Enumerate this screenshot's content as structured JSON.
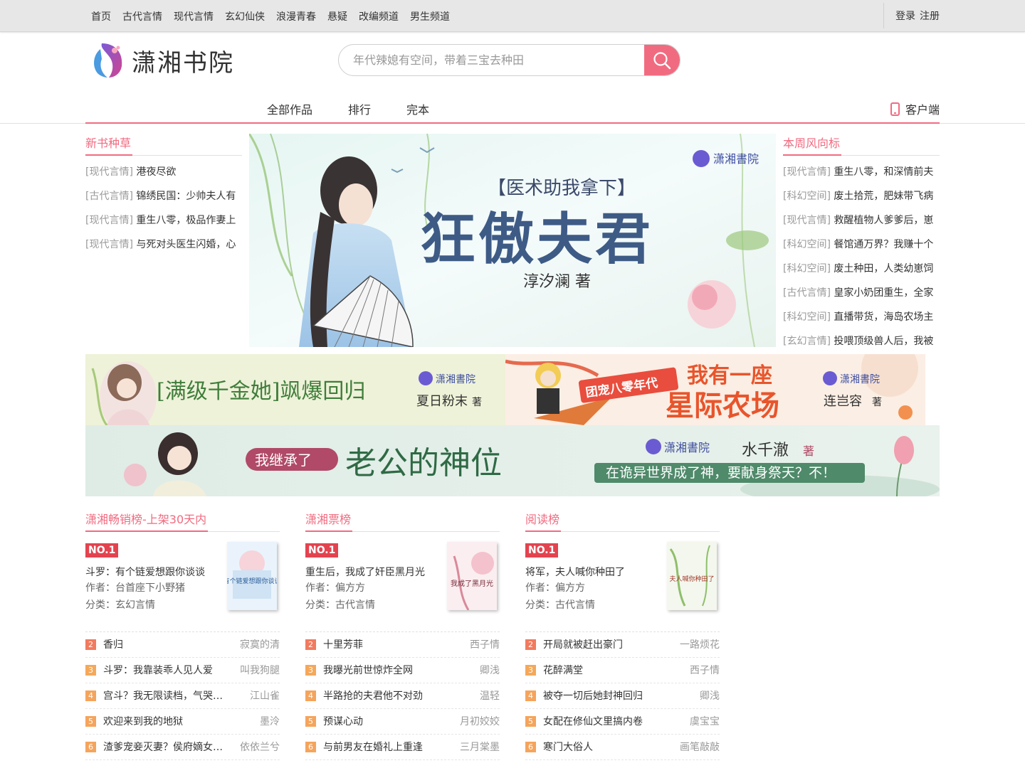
{
  "topnav": {
    "items": [
      "首页",
      "古代言情",
      "现代言情",
      "玄幻仙侠",
      "浪漫青春",
      "悬疑",
      "改编频道",
      "男生频道"
    ],
    "login": "登录",
    "register": "注册"
  },
  "header": {
    "logo_text": "潇湘书院",
    "search_placeholder": "年代辣媳有空间，带着三宝去种田"
  },
  "mainnav": {
    "items": [
      "全部作品",
      "排行",
      "完本"
    ],
    "client": "客户端"
  },
  "new_books": {
    "title": "新书种草",
    "items": [
      {
        "cat": "[现代言情]",
        "name": "港夜尽欲"
      },
      {
        "cat": "[古代言情]",
        "name": "锦绣民国：少帅夫人有"
      },
      {
        "cat": "[现代言情]",
        "name": "重生八零，极品作妻上"
      },
      {
        "cat": "[现代言情]",
        "name": "与死对头医生闪婚，心"
      }
    ]
  },
  "weekly": {
    "title": "本周风向标",
    "items": [
      {
        "cat": "[现代言情]",
        "name": "重生八零，和深情前夫"
      },
      {
        "cat": "[科幻空间]",
        "name": "废土拾荒，肥妹带飞病"
      },
      {
        "cat": "[现代言情]",
        "name": "救醒植物人爹爹后，崽"
      },
      {
        "cat": "[科幻空间]",
        "name": "餐馆通万界？我赚十个"
      },
      {
        "cat": "[科幻空间]",
        "name": "废土种田，人类幼崽饲"
      },
      {
        "cat": "[古代言情]",
        "name": "皇家小奶团重生，全家"
      },
      {
        "cat": "[科幻空间]",
        "name": "直播带货，海岛农场主"
      },
      {
        "cat": "[玄幻言情]",
        "name": "投喂顶级兽人后，我被"
      }
    ]
  },
  "banners": {
    "main": {
      "tagline": "【医术助我拿下】",
      "title": "狂傲夫君",
      "author": "淳汐澜 著",
      "brand": "潇湘書院"
    },
    "b2": {
      "title": "[满级千金她]飒爆回归",
      "author": "夏日粉末",
      "zhu": "著",
      "brand": "潇湘書院"
    },
    "b3": {
      "tag": "团宠八零年代",
      "title1": "我有一座",
      "title2": "星际农场",
      "author": "连岂容",
      "zhu": "著",
      "brand": "潇湘書院"
    },
    "b4": {
      "lead": "我继承了",
      "title": "老公的神位",
      "author": "水千澈",
      "zhu": "著",
      "sub": "在诡异世界成了神，要献身祭天？不！",
      "brand": "潇湘書院"
    }
  },
  "ranks": [
    {
      "title": "潇湘畅销榜-上架30天内",
      "no1_label": "NO.1",
      "top": {
        "title": "斗罗：有个链爱想跟你谈谈",
        "author": "作者：台首座下小野猪",
        "category": "分类：玄幻言情",
        "cover_text": "有个链爱想跟你谈谈"
      },
      "list": [
        {
          "n": "2",
          "name": "香归",
          "author": "寂寞的清"
        },
        {
          "n": "3",
          "name": "斗罗：我靠装乖人见人爱",
          "author": "叫我狗腿"
        },
        {
          "n": "4",
          "name": "宫斗？我无限读档，气哭…",
          "author": "江山雀"
        },
        {
          "n": "5",
          "name": "欢迎来到我的地狱",
          "author": "墨泠"
        },
        {
          "n": "6",
          "name": "渣爹宠妾灭妻？侯府嫡女…",
          "author": "依依兰兮"
        }
      ]
    },
    {
      "title": "潇湘票榜",
      "no1_label": "NO.1",
      "top": {
        "title": "重生后，我成了奸臣黑月光",
        "author": "作者：偏方方",
        "category": "分类：古代言情",
        "cover_text": "我成了黑月光"
      },
      "list": [
        {
          "n": "2",
          "name": "十里芳菲",
          "author": "西子情"
        },
        {
          "n": "3",
          "name": "我曝光前世惊炸全网",
          "author": "卿浅"
        },
        {
          "n": "4",
          "name": "半路抢的夫君他不对劲",
          "author": "温轻"
        },
        {
          "n": "5",
          "name": "预谋心动",
          "author": "月初姣姣"
        },
        {
          "n": "6",
          "name": "与前男友在婚礼上重逢",
          "author": "三月棠墨"
        }
      ]
    },
    {
      "title": "阅读榜",
      "no1_label": "NO.1",
      "top": {
        "title": "将军，夫人喊你种田了",
        "author": "作者：偏方方",
        "category": "分类：古代言情",
        "cover_text": "夫人喊你种田了"
      },
      "list": [
        {
          "n": "2",
          "name": "开局就被赶出豪门",
          "author": "一路烦花"
        },
        {
          "n": "3",
          "name": "花醉满堂",
          "author": "西子情"
        },
        {
          "n": "4",
          "name": "被夺一切后她封神回归",
          "author": "卿浅"
        },
        {
          "n": "5",
          "name": "女配在修仙文里搞内卷",
          "author": "虞宝宝"
        },
        {
          "n": "6",
          "name": "寒门大俗人",
          "author": "画笔敲敲"
        }
      ]
    }
  ],
  "colors": {
    "accent": "#f16b80",
    "no1": "#e3434f"
  },
  "icons": [
    "search-icon",
    "phone-icon",
    "logo-icon"
  ]
}
